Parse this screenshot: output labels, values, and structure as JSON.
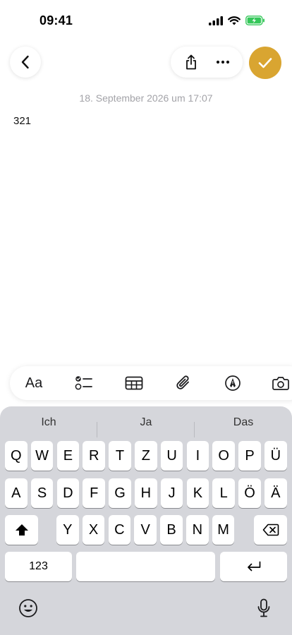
{
  "status": {
    "time": "09:41"
  },
  "note": {
    "date": "18. September 2026 um 17:07",
    "body": "321"
  },
  "toolbar": {
    "format_label": "Aa"
  },
  "colors": {
    "accent": "#d9a531",
    "keyboard_bg": "#d5d6db",
    "battery": "#34c759"
  },
  "keyboard": {
    "suggestions": [
      "Ich",
      "Ja",
      "Das"
    ],
    "row1": [
      "Q",
      "W",
      "E",
      "R",
      "T",
      "Z",
      "U",
      "I",
      "O",
      "P",
      "Ü"
    ],
    "row2": [
      "A",
      "S",
      "D",
      "F",
      "G",
      "H",
      "J",
      "K",
      "L",
      "Ö",
      "Ä"
    ],
    "row3": [
      "Y",
      "X",
      "C",
      "V",
      "B",
      "N",
      "M"
    ],
    "numbers_label": "123"
  },
  "icons": [
    "back-icon",
    "share-icon",
    "more-icon",
    "checkmark-icon",
    "checklist-icon",
    "table-icon",
    "paperclip-icon",
    "markup-icon",
    "camera-icon",
    "shift-icon",
    "backspace-icon",
    "return-icon",
    "emoji-icon",
    "microphone-icon"
  ]
}
